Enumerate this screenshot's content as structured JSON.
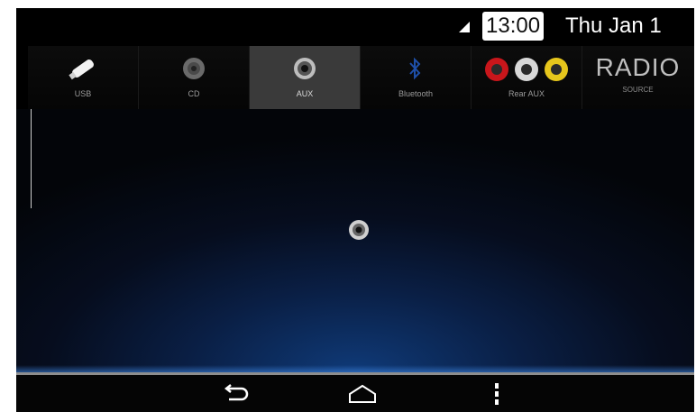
{
  "status": {
    "time": "13:00",
    "date": "Thu Jan 1",
    "icons": [
      "signal-icon"
    ]
  },
  "sources": [
    {
      "label": "USB",
      "icon": "usb-icon",
      "active": false
    },
    {
      "label": "CD",
      "icon": "cd-icon",
      "active": false
    },
    {
      "label": "AUX",
      "icon": "aux-jack-icon",
      "active": true
    },
    {
      "label": "Bluetooth",
      "icon": "bluetooth-icon",
      "active": false
    },
    {
      "label": "Rear AUX",
      "icon": "rca-jacks-icon",
      "active": false
    },
    {
      "label": "RADIO",
      "sublabel": "SOURCE",
      "icon": "radio-text",
      "active": false
    }
  ],
  "main": {
    "current_source_icon": "aux-jack-icon"
  },
  "nav": {
    "buttons": [
      "back-icon",
      "home-icon",
      "menu-icon"
    ]
  },
  "colors": {
    "background": "#000000",
    "active_tab": "#3a3a3a",
    "clock_bg": "#ffffff",
    "main_glow": "#0f3a78"
  }
}
